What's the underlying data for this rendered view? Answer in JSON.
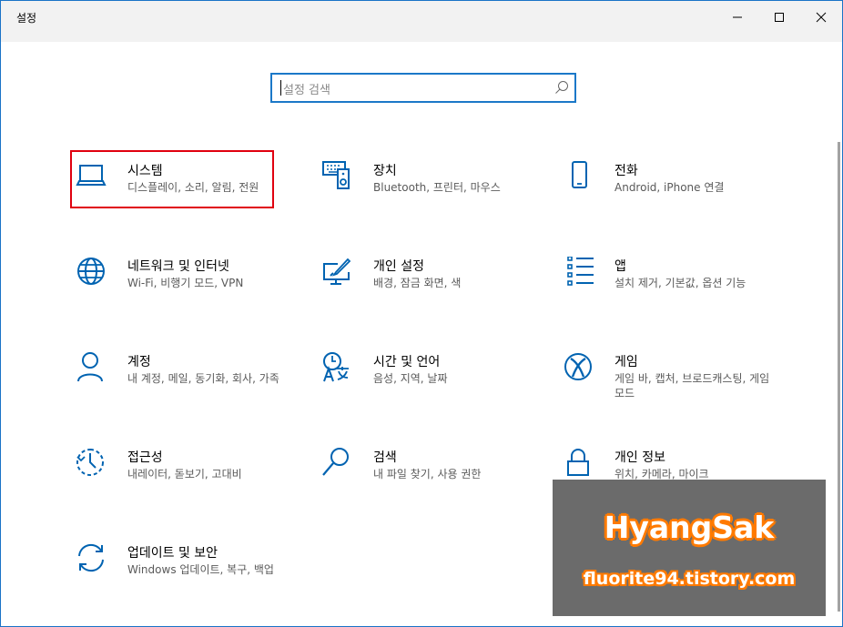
{
  "window": {
    "title": "설정",
    "accent_color": "#0078d7",
    "highlight_color": "#e0000f"
  },
  "search": {
    "placeholder": "설정 검색",
    "icon": "search-icon"
  },
  "tiles": [
    {
      "id": "system",
      "name": "시스템",
      "desc": "디스플레이, 소리, 알림, 전원",
      "icon": "laptop-icon",
      "selected": true
    },
    {
      "id": "devices",
      "name": "장치",
      "desc": "Bluetooth, 프린터, 마우스",
      "icon": "keyboard-speaker-icon"
    },
    {
      "id": "phone",
      "name": "전화",
      "desc": "Android, iPhone 연결",
      "icon": "phone-icon"
    },
    {
      "id": "network",
      "name": "네트워크 및 인터넷",
      "desc": "Wi-Fi, 비행기 모드, VPN",
      "icon": "globe-icon"
    },
    {
      "id": "personalization",
      "name": "개인 설정",
      "desc": "배경, 잠금 화면, 색",
      "icon": "paint-monitor-icon"
    },
    {
      "id": "apps",
      "name": "앱",
      "desc": "설치 제거, 기본값, 옵션 기능",
      "icon": "app-list-icon"
    },
    {
      "id": "accounts",
      "name": "계정",
      "desc": "내 계정, 메일, 동기화, 회사, 가족",
      "icon": "person-icon"
    },
    {
      "id": "time-language",
      "name": "시간 및 언어",
      "desc": "음성, 지역, 날짜",
      "icon": "clock-language-icon"
    },
    {
      "id": "gaming",
      "name": "게임",
      "desc": "게임 바, 캡처, 브로드캐스팅, 게임 모드",
      "icon": "xbox-icon"
    },
    {
      "id": "ease-of-access",
      "name": "접근성",
      "desc": "내레이터, 돋보기, 고대비",
      "icon": "ease-of-access-icon"
    },
    {
      "id": "search",
      "name": "검색",
      "desc": "내 파일 찾기, 사용 권한",
      "icon": "magnifier-icon"
    },
    {
      "id": "privacy",
      "name": "개인 정보",
      "desc": "위치, 카메라, 마이크",
      "icon": "lock-icon"
    },
    {
      "id": "update-security",
      "name": "업데이트 및 보안",
      "desc": "Windows 업데이트, 복구, 백업",
      "icon": "sync-icon"
    }
  ],
  "watermark": {
    "title": "HyangSak",
    "subtitle": "fluorite94.tistory.com"
  }
}
